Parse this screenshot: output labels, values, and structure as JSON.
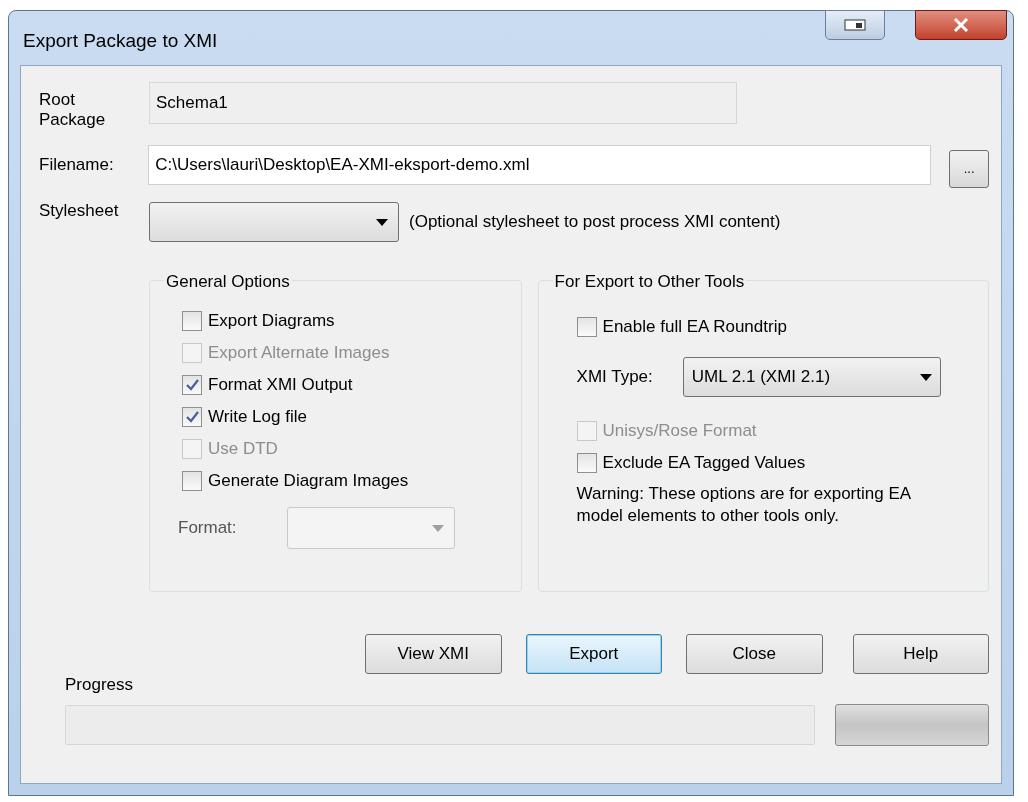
{
  "window": {
    "title": "Export Package to XMI"
  },
  "root_package": {
    "label": "Root Package",
    "value": "Schema1"
  },
  "filename": {
    "label": "Filename:",
    "value": "C:\\Users\\lauri\\Desktop\\EA-XMI-eksport-demo.xml",
    "browse": "..."
  },
  "stylesheet": {
    "label": "Stylesheet",
    "note": "(Optional stylesheet to post process XMI content)"
  },
  "general_options": {
    "title": "General Options",
    "options": [
      {
        "label": "Export Diagrams",
        "checked": false,
        "disabled": false
      },
      {
        "label": "Export Alternate Images",
        "checked": false,
        "disabled": true
      },
      {
        "label": "Format XMI Output",
        "checked": true,
        "disabled": false
      },
      {
        "label": "Write Log file",
        "checked": true,
        "disabled": false
      },
      {
        "label": "Use DTD",
        "checked": false,
        "disabled": true
      },
      {
        "label": "Generate Diagram Images",
        "checked": false,
        "disabled": false
      }
    ],
    "format": {
      "label": "Format:",
      "disabled": true
    }
  },
  "export_tools": {
    "title": "For Export to Other Tools",
    "roundtrip": {
      "label": "Enable full EA Roundtrip",
      "checked": false,
      "disabled": false
    },
    "xmi_type": {
      "label": "XMI Type:",
      "value": "UML 2.1 (XMI 2.1)"
    },
    "options": [
      {
        "label": "Unisys/Rose Format",
        "checked": false,
        "disabled": true
      },
      {
        "label": "Exclude EA Tagged Values",
        "checked": false,
        "disabled": false
      }
    ],
    "warning": "Warning: These options are for exporting EA model elements to other tools only."
  },
  "buttons": [
    {
      "label": "View XMI",
      "default": false
    },
    {
      "label": "Export",
      "default": true
    },
    {
      "label": "Close",
      "default": false
    },
    {
      "label": "Help",
      "default": false
    }
  ],
  "progress": {
    "label": "Progress",
    "level": 0
  }
}
